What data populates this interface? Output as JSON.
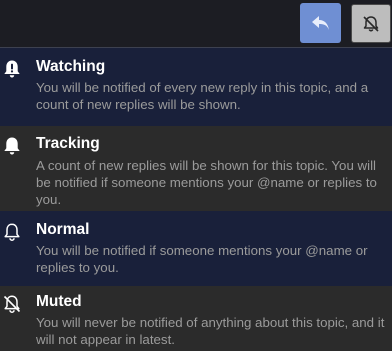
{
  "header": {
    "reply_icon": "reply-arrow-icon",
    "notifications_icon": "bell-slash-icon"
  },
  "options": [
    {
      "key": "watching",
      "icon": "bell-exclamation-icon",
      "title": "Watching",
      "description": "You will be notified of every new reply in this topic, and a count of new replies will be shown."
    },
    {
      "key": "tracking",
      "icon": "bell-icon",
      "title": "Tracking",
      "description": "A count of new replies will be shown for this topic. You will be notified if someone mentions your @name or replies to you."
    },
    {
      "key": "normal",
      "icon": "bell-outline-icon",
      "title": "Normal",
      "description": "You will be notified if someone mentions your @name or replies to you."
    },
    {
      "key": "muted",
      "icon": "bell-slash-icon",
      "title": "Muted",
      "description": "You will never be notified of anything about this topic, and it will not appear in latest."
    }
  ],
  "colors": {
    "accent": "#6f8fd3",
    "row_dark_blue": "#19203a",
    "row_gray": "#2b2b2b",
    "title": "#ffffff",
    "description": "#9b9b9b"
  }
}
